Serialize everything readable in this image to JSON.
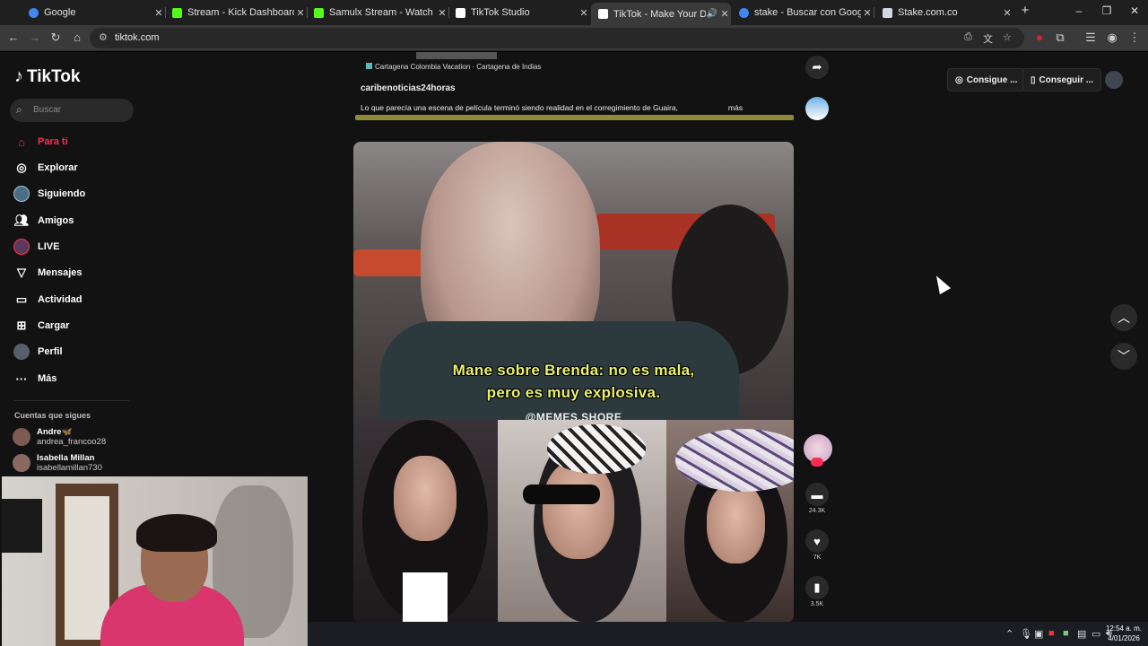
{
  "browser": {
    "tabs": [
      {
        "title": "Google",
        "favicon_color": "#4285f4",
        "active": false
      },
      {
        "title": "Stream - Kick Dashboard",
        "favicon_color": "#53fc18",
        "active": false
      },
      {
        "title": "Samulx Stream - Watch Live on",
        "favicon_color": "#53fc18",
        "active": false
      },
      {
        "title": "TikTok Studio",
        "favicon_color": "#ffffff",
        "active": false
      },
      {
        "title": "TikTok - Make Your Day",
        "favicon_color": "#ffffff",
        "active": true
      },
      {
        "title": "stake - Buscar con Google",
        "favicon_color": "#4285f4",
        "active": false
      },
      {
        "title": "Stake.com.co",
        "favicon_color": "#cfd8e3",
        "active": false
      }
    ],
    "url": "tiktok.com"
  },
  "sidebar": {
    "logo": "TikTok",
    "search_placeholder": "Buscar",
    "items": [
      {
        "label": "Para ti",
        "icon": "home-icon",
        "active": true
      },
      {
        "label": "Explorar",
        "icon": "compass-icon",
        "active": false
      },
      {
        "label": "Siguiendo",
        "icon": "following-avatar-icon",
        "active": false
      },
      {
        "label": "Amigos",
        "icon": "friends-icon",
        "active": false
      },
      {
        "label": "LIVE",
        "icon": "live-icon",
        "active": false
      },
      {
        "label": "Mensajes",
        "icon": "messages-icon",
        "active": false
      },
      {
        "label": "Actividad",
        "icon": "activity-icon",
        "active": false
      },
      {
        "label": "Cargar",
        "icon": "upload-icon",
        "active": false
      },
      {
        "label": "Perfil",
        "icon": "profile-icon",
        "active": false
      },
      {
        "label": "Más",
        "icon": "more-icon",
        "active": false
      }
    ],
    "following_title": "Cuentas que sigues",
    "following": [
      {
        "name": "Andre🦋",
        "handle": "andrea_francoo28"
      },
      {
        "name": "Isabella Millan",
        "handle": "isabellamillan730"
      }
    ]
  },
  "header": {
    "btn1": "Consigue ...",
    "btn2": "Conseguir ..."
  },
  "previous_post": {
    "tag": "Cartagena Colombia Vacation · Cartagena de Indias",
    "username": "caribenoticias24horas",
    "description": "Lo que parecía una escena de película terminó siendo realidad en el corregimiento de Guaira,",
    "more": "más"
  },
  "video": {
    "subtitle_line1": "Mane sobre Brenda: no es mala,",
    "subtitle_line2": "pero es muy explosiva.",
    "watermark": "@MEMES.SHORE"
  },
  "actions": {
    "comments": "24.3K",
    "likes": "7K",
    "saves": "3.5K"
  },
  "system": {
    "time": "12:54 a. m.",
    "date": "4/01/2026"
  }
}
